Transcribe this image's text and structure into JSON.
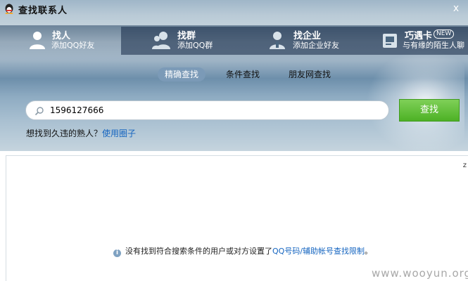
{
  "window": {
    "title": "查找联系人",
    "close_glyph": "x"
  },
  "tabs": [
    {
      "title": "找人",
      "subtitle": "添加QQ好友",
      "icon": "person-icon"
    },
    {
      "title": "找群",
      "subtitle": "添加QQ群",
      "icon": "group-icon"
    },
    {
      "title": "找企业",
      "subtitle": "添加企业好友",
      "icon": "enterprise-icon"
    },
    {
      "title": "巧遇卡",
      "subtitle": "与有缘的陌生人聊",
      "icon": "card-icon",
      "badge": "NEW"
    }
  ],
  "modes": [
    {
      "label": "精确查找",
      "active": true
    },
    {
      "label": "条件查找",
      "active": false
    },
    {
      "label": "朋友网查找",
      "active": false
    }
  ],
  "search": {
    "value": "1596127666",
    "button_label": "查找",
    "icon": "search-icon"
  },
  "hint": {
    "text": "想找到久违的熟人？",
    "link": "使用圈子"
  },
  "results": {
    "collapse_glyph": "z",
    "empty_text": "没有找到符合搜索条件的用户或对方设置了",
    "empty_link": "QQ号码/辅助帐号查找限制",
    "empty_tail": "。",
    "info_icon": "info-icon"
  },
  "watermark": "www.wooyun.org",
  "colors": {
    "search_button": "#4db125",
    "active_mode": "#7b9ab7",
    "link": "#1565c0"
  }
}
